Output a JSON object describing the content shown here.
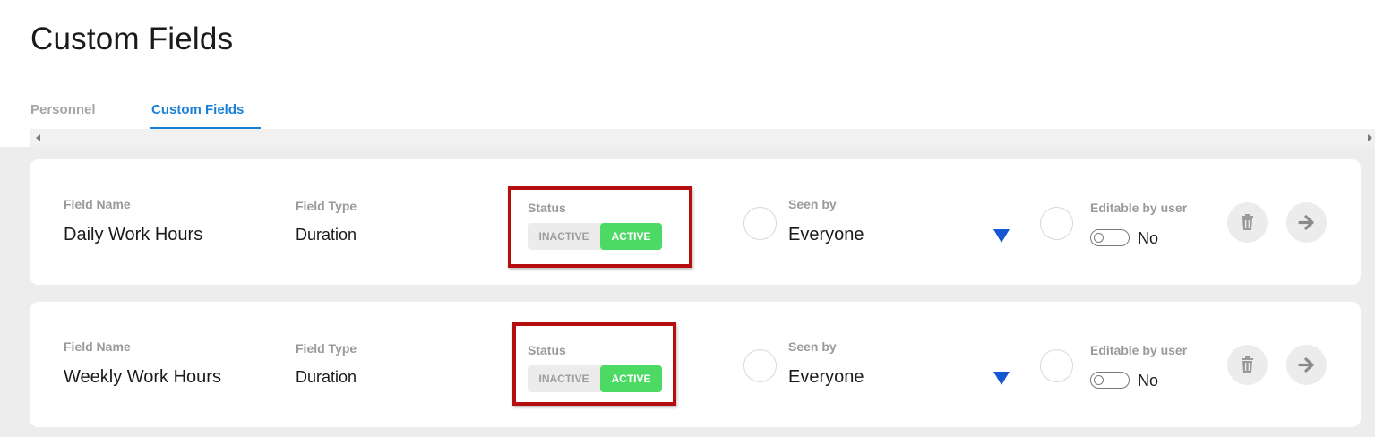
{
  "page": {
    "title": "Custom Fields"
  },
  "tabs": [
    {
      "label": "Personnel",
      "active": false
    },
    {
      "label": "Custom Fields",
      "active": true
    }
  ],
  "colors": {
    "accent_blue": "#1a7fd6",
    "active_green": "#4cd964",
    "highlight_red": "#b60e0e",
    "dropdown_blue": "#1557d2"
  },
  "labels": {
    "field_name": "Field Name",
    "field_type": "Field Type",
    "status": "Status",
    "seen_by": "Seen by",
    "editable_by_user": "Editable by user",
    "inactive": "INACTIVE",
    "active": "ACTIVE"
  },
  "fields": [
    {
      "name": "Daily Work Hours",
      "type": "Duration",
      "status": "ACTIVE",
      "seen_by": "Everyone",
      "editable_text": "No",
      "editable": false
    },
    {
      "name": "Weekly Work Hours",
      "type": "Duration",
      "status": "ACTIVE",
      "seen_by": "Everyone",
      "editable_text": "No",
      "editable": false
    }
  ],
  "icons": {
    "delete": "trash-icon",
    "open": "arrow-right-icon",
    "dropdown": "triangle-down-icon"
  }
}
